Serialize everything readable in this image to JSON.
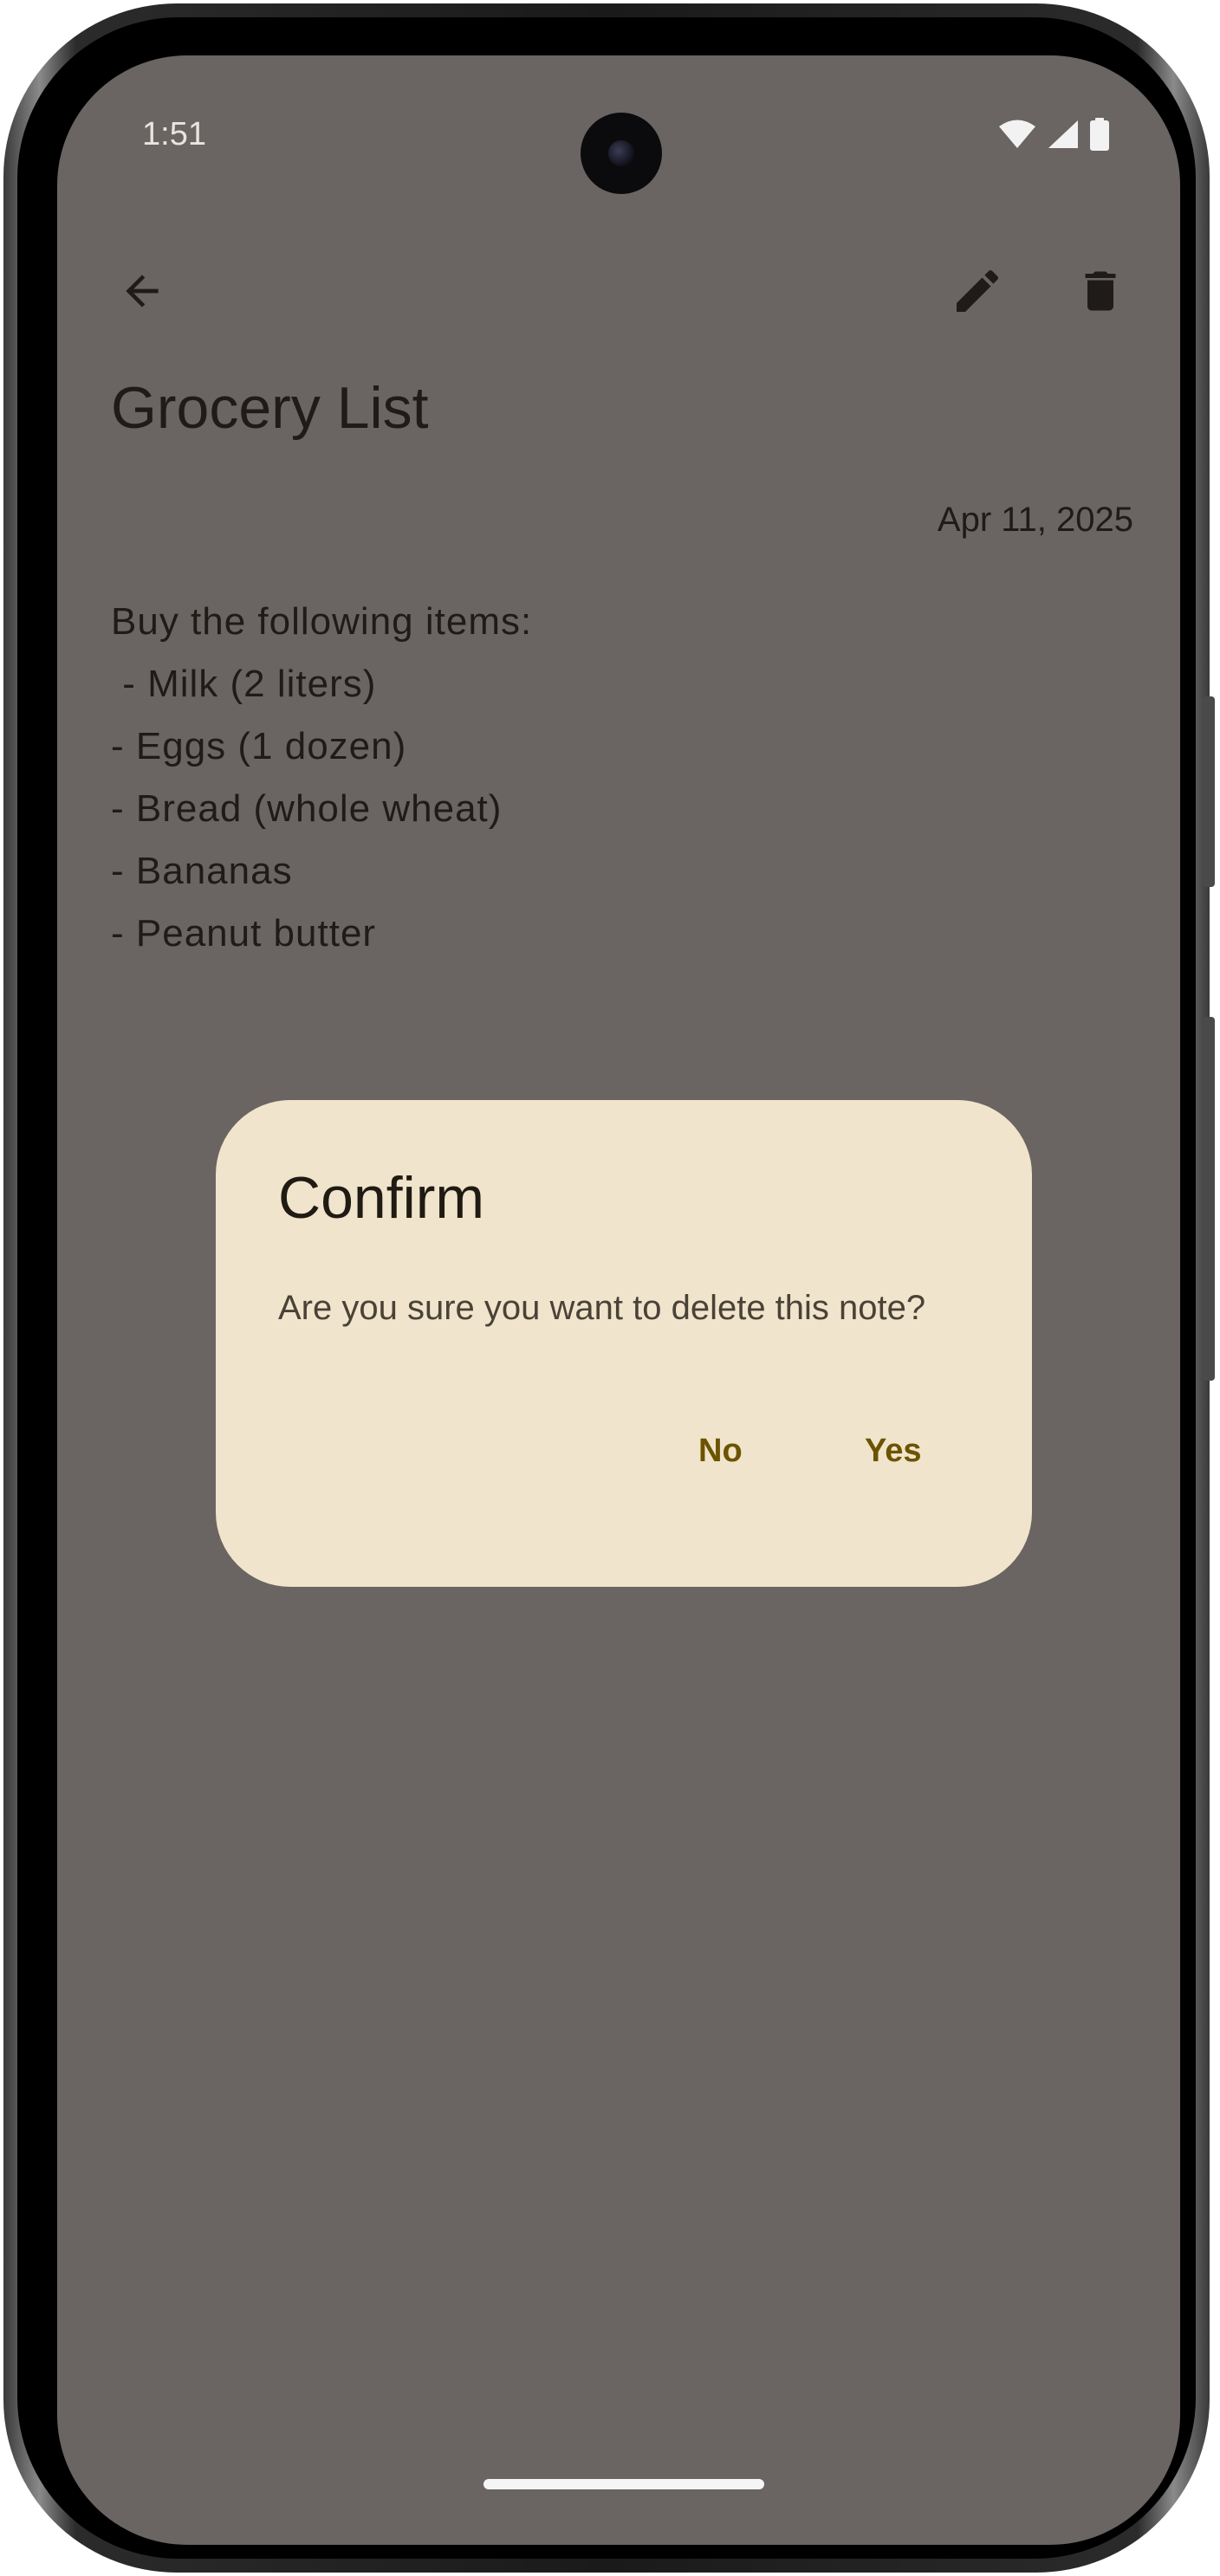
{
  "status_bar": {
    "time": "1:51",
    "icons": [
      "wifi-icon",
      "cellular-signal-icon",
      "battery-icon"
    ]
  },
  "toolbar": {
    "back_icon": "arrow-back-icon",
    "edit_icon": "edit-pencil-icon",
    "delete_icon": "trash-icon"
  },
  "note": {
    "title": "Grocery List",
    "date": "Apr 11, 2025",
    "lines": [
      "Buy the following items:",
      " - Milk (2 liters)",
      "- Eggs (1 dozen)",
      "- Bread (whole wheat)",
      "- Bananas",
      "- Peanut butter"
    ]
  },
  "dialog": {
    "title": "Confirm",
    "message": "Are you sure you want to delete this note?",
    "no_label": "No",
    "yes_label": "Yes"
  },
  "colors": {
    "scrim_background": "#6a6562",
    "dialog_surface": "#f0e4cc",
    "dialog_button_text": "#6b5300",
    "text_primary": "#1e1b18"
  }
}
